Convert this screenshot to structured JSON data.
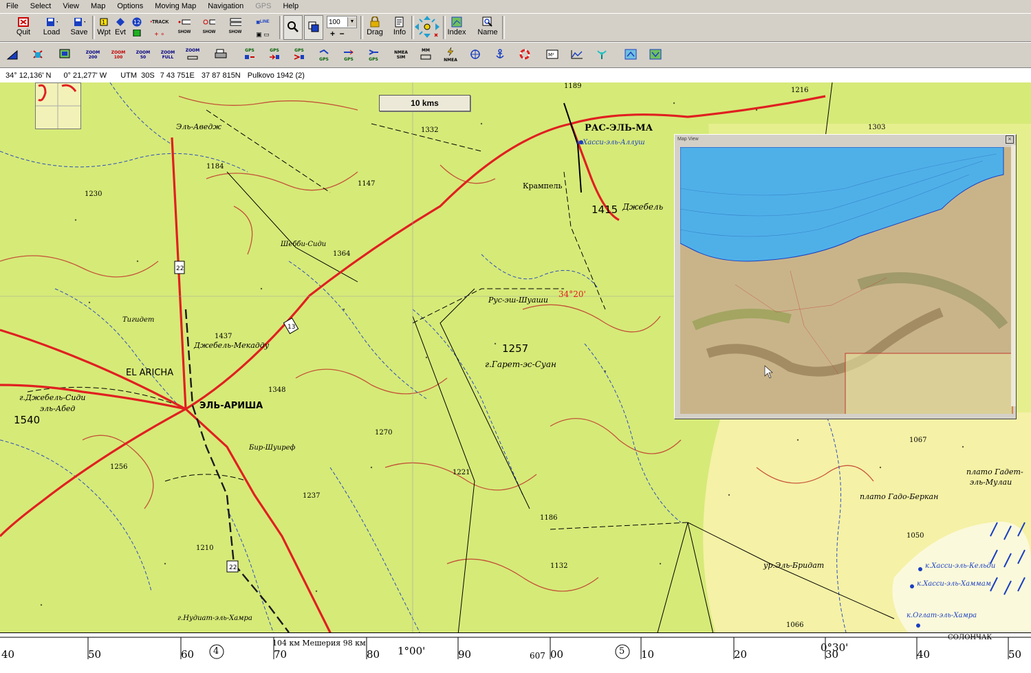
{
  "menu": [
    "File",
    "Select",
    "View",
    "Map",
    "Options",
    "Moving Map",
    "Navigation",
    "GPS",
    "Help"
  ],
  "menu_disabled": [
    "GPS"
  ],
  "toolbar": {
    "quit": "Quit",
    "load": "Load",
    "save": "Save",
    "wpt": "Wpt",
    "evt": "Evt",
    "track": "TRACK",
    "show1": "SHOW",
    "show2": "SHOW",
    "show3": "SHOW",
    "line": "LINE",
    "zoom_value": "100",
    "drag": "Drag",
    "info": "Info",
    "index": "Index",
    "name": "Name"
  },
  "toolbar2": {
    "zoom200": "ZOOM\n200",
    "zoom100": "ZOOM\n100",
    "zoom50": "ZOOM\n50",
    "zoomfull": "ZOOM\nFULL",
    "zoomother": "ZOOM",
    "gps": "GPS",
    "nmea_sim": "NMEA\nSIM",
    "mm": "MM",
    "nmea": "NMEA"
  },
  "status": {
    "lat": "34° 12,136' N",
    "lon": "0° 21,277' W",
    "utm": "UTM  30S",
    "easting": "7 43 751E",
    "northing": "37 87 815N",
    "datum": "Pulkovo 1942 (2)"
  },
  "scale_label": "10 kms",
  "map_view_title": "Map View",
  "map_labels": {
    "ras_el_ma": "РАС-ЭЛЬ-МА",
    "el_aricha_latin": "EL ARICHA",
    "el_aricha": "ЭЛЬ-АРИША",
    "lat_marker": "34°20'",
    "hassi_ellalouch": "к.Хасси-эль-Аллуш",
    "dzhebel_sidi": "г.Джебель-Сиди",
    "el_abed": "эль-Абед",
    "elev_1540": "1540",
    "elev_1257": "1257",
    "garet": "г.Гарет-эс-Суан",
    "elev_1415": "1415",
    "dzhebel": "Джебель",
    "krampel": "Крампель",
    "el_aveg": "Эль-Аведж",
    "elev_1364": "1364",
    "shebbi": "Шебби-Сиди",
    "rus": "Рус-эш-Шуаши",
    "tigident": "Тигидет",
    "dzhebel_mekaddu": "Джебель-Мекадду",
    "elev_1437": "1437",
    "elev_1348": "1348",
    "elev_1270": "1270",
    "elev_1256": "1256",
    "elev_1221": "1221",
    "elev_1237": "1237",
    "elev_1186": "1186",
    "elev_1210": "1210",
    "elev_1132": "1132",
    "elev_1147": "1147",
    "elev_1230": "1230",
    "elev_1184": "1184",
    "elev_1332": "1332",
    "elev_1189": "1189",
    "elev_1216": "1216",
    "elev_1303": "1303",
    "elev_1067": "1067",
    "elev_1050": "1050",
    "elev_1066": "1066",
    "bir_shuiref": "Бир-Шуиреф",
    "plato_gadet": "плато Гадет-",
    "el_mulai": "эль-Мулаи",
    "plato_gado": "плато Гадо-Беркан",
    "ur_el_bridat": "ур.Эль-Бридат",
    "hassi_kelydi": "к.Хасси-эль-Кельди",
    "hassi_hammam": "к.Хасси-эль-Хаммам",
    "oglat_hamra": "к.Оглат-эль-Хамра",
    "nudiat": "г.Нудиат-эль-Хамра",
    "road_22": "22",
    "road_13": "13",
    "road_22b": "22",
    "sol": "СОЛОНЧАК"
  },
  "bottom_scale": {
    "ticks": [
      "40",
      "50",
      "60",
      "70",
      "80",
      "90",
      "00",
      "10",
      "20",
      "30",
      "40",
      "50"
    ],
    "circle4": "4",
    "circle5": "5",
    "mesheria": "104 км Мешерия 98 км",
    "lon1": "1°00'",
    "lon2": "0°30'",
    "e607": "607"
  },
  "colors": {
    "map_green": "#d8ea7a",
    "map_yellow": "#f6f3a8",
    "road_red": "#e02020",
    "water_blue": "#1a3fc0",
    "contour": "#c0392b",
    "sea": "#4fb0e8"
  }
}
